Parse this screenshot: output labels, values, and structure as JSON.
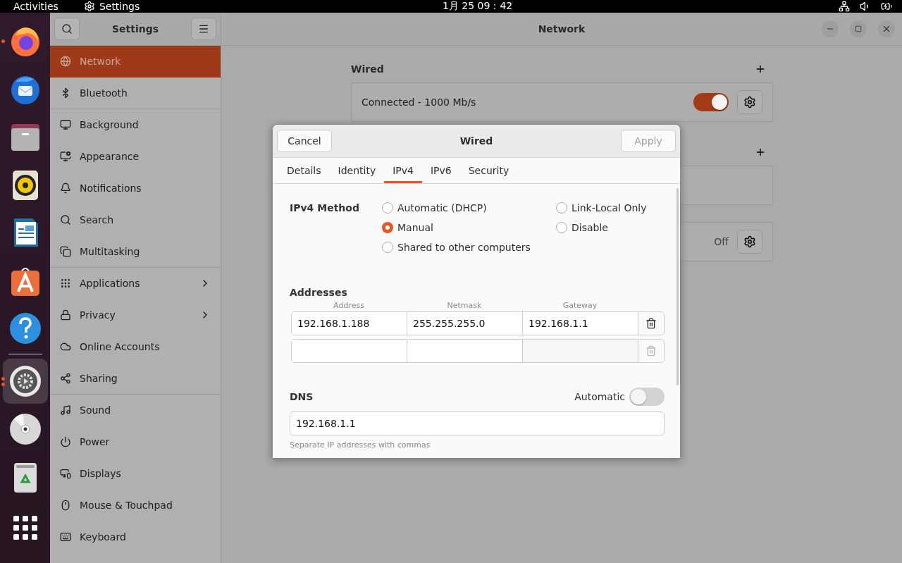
{
  "top_bar": {
    "activities": "Activities",
    "app_name": "Settings",
    "clock": "1月 25  09：42"
  },
  "dock": [
    {
      "running": true,
      "selected": false
    },
    {
      "running": false,
      "selected": false
    },
    {
      "running": false,
      "selected": false
    },
    {
      "running": false,
      "selected": false
    },
    {
      "running": false,
      "selected": false
    },
    {
      "running": false,
      "selected": false
    },
    {
      "running": false,
      "selected": false
    },
    {
      "running": true,
      "selected": true
    },
    {
      "running": false,
      "selected": false
    },
    {
      "running": false,
      "selected": false
    },
    {
      "running": false,
      "selected": false
    }
  ],
  "sidebar": {
    "title": "Settings",
    "items": [
      {
        "label": "Network",
        "selected": true,
        "submenu": false,
        "separator_after": false
      },
      {
        "label": "Bluetooth",
        "selected": false,
        "submenu": false,
        "separator_after": true
      },
      {
        "label": "Background",
        "selected": false,
        "submenu": false,
        "separator_after": false
      },
      {
        "label": "Appearance",
        "selected": false,
        "submenu": false,
        "separator_after": false
      },
      {
        "label": "Notifications",
        "selected": false,
        "submenu": false,
        "separator_after": false
      },
      {
        "label": "Search",
        "selected": false,
        "submenu": false,
        "separator_after": false
      },
      {
        "label": "Multitasking",
        "selected": false,
        "submenu": false,
        "separator_after": true
      },
      {
        "label": "Applications",
        "selected": false,
        "submenu": true,
        "separator_after": false
      },
      {
        "label": "Privacy",
        "selected": false,
        "submenu": true,
        "separator_after": false
      },
      {
        "label": "Online Accounts",
        "selected": false,
        "submenu": false,
        "separator_after": false
      },
      {
        "label": "Sharing",
        "selected": false,
        "submenu": false,
        "separator_after": true
      },
      {
        "label": "Sound",
        "selected": false,
        "submenu": false,
        "separator_after": false
      },
      {
        "label": "Power",
        "selected": false,
        "submenu": false,
        "separator_after": false
      },
      {
        "label": "Displays",
        "selected": false,
        "submenu": false,
        "separator_after": false
      },
      {
        "label": "Mouse & Touchpad",
        "selected": false,
        "submenu": false,
        "separator_after": false
      },
      {
        "label": "Keyboard",
        "selected": false,
        "submenu": false,
        "separator_after": false
      }
    ]
  },
  "window": {
    "title": "Network"
  },
  "network": {
    "sections": [
      {
        "title": "Wired",
        "cards": [
          {
            "kind": "device",
            "status": "Connected - 1000 Mb/s",
            "on": true
          }
        ]
      },
      {
        "cards": [
          {
            "kind": "blank"
          }
        ]
      },
      {
        "cards": [
          {
            "kind": "device",
            "status": "Off",
            "on": false
          }
        ]
      }
    ]
  },
  "dialog": {
    "cancel": "Cancel",
    "title": "Wired",
    "apply": {
      "label": "Apply",
      "disabled": true
    },
    "tabs": [
      {
        "label": "Details",
        "selected": false
      },
      {
        "label": "Identity",
        "selected": false
      },
      {
        "label": "IPv4",
        "selected": true
      },
      {
        "label": "IPv6",
        "selected": false
      },
      {
        "label": "Security",
        "selected": false
      }
    ],
    "method_label": "IPv4 Method",
    "methods": [
      {
        "label": "Automatic (DHCP)",
        "selected": false
      },
      {
        "label": "Manual",
        "selected": true
      },
      {
        "label": "Shared to other computers",
        "selected": false
      },
      {
        "label": "Link-Local Only",
        "selected": false
      },
      {
        "label": "Disable",
        "selected": false
      }
    ],
    "addresses_label": "Addresses",
    "columns": [
      "Address",
      "Netmask",
      "Gateway"
    ],
    "rows": [
      {
        "address": "192.168.1.188",
        "netmask": "255.255.255.0",
        "gateway": "192.168.1.1",
        "delete_disabled": false
      },
      {
        "delete_disabled": true
      }
    ],
    "dns_label": "DNS",
    "automatic_label": "Automatic",
    "automatic_on": false,
    "dns_value": "192.168.1.1",
    "dns_hint": "Separate IP addresses with commas"
  }
}
